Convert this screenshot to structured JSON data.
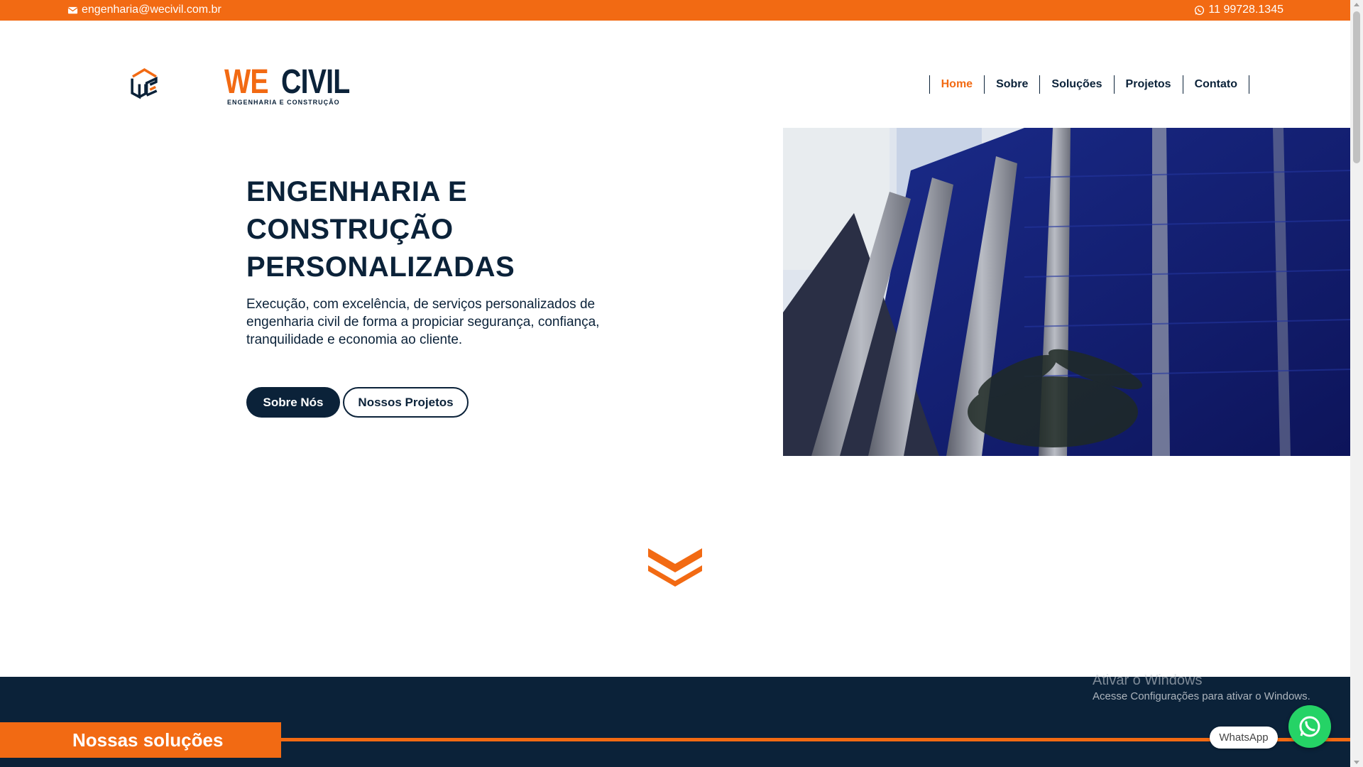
{
  "topbar": {
    "email": "engenharia@wecivil.com.br",
    "phone": "11 99728.1345",
    "email_icon": "envelope-icon",
    "phone_icon": "whatsapp-icon"
  },
  "brand": {
    "name_we": "WE",
    "name_civil": "CIVIL",
    "subtitle": "ENGENHARIA E CONSTRUÇÃO",
    "logo_icon": "we-civil-logo"
  },
  "nav": {
    "items": [
      {
        "label": "Home",
        "active": true
      },
      {
        "label": "Sobre"
      },
      {
        "label": "Soluções"
      },
      {
        "label": "Projetos"
      },
      {
        "label": "Contato"
      }
    ]
  },
  "hero": {
    "title_lines": [
      "ENGENHARIA E",
      "CONSTRUÇÃO",
      "PERSONALIZADAS"
    ],
    "text": "Execução, com excelência, de serviços personalizados de engenharia civil de forma a propiciar segurança, confiança, tranquilidade e economia ao cliente.",
    "btn_primary": "Sobre Nós",
    "btn_secondary": "Nossos Projetos"
  },
  "section": {
    "solutions_label": "Nossas soluções"
  },
  "windows_notice": {
    "title": "Ativar o Windows",
    "subtitle": "Acesse Configurações para ativar o Windows."
  },
  "whatsapp": {
    "label": "WhatsApp"
  },
  "colors": {
    "accent": "#f26a13",
    "navy": "#0b2239",
    "whatsapp": "#25d366"
  }
}
